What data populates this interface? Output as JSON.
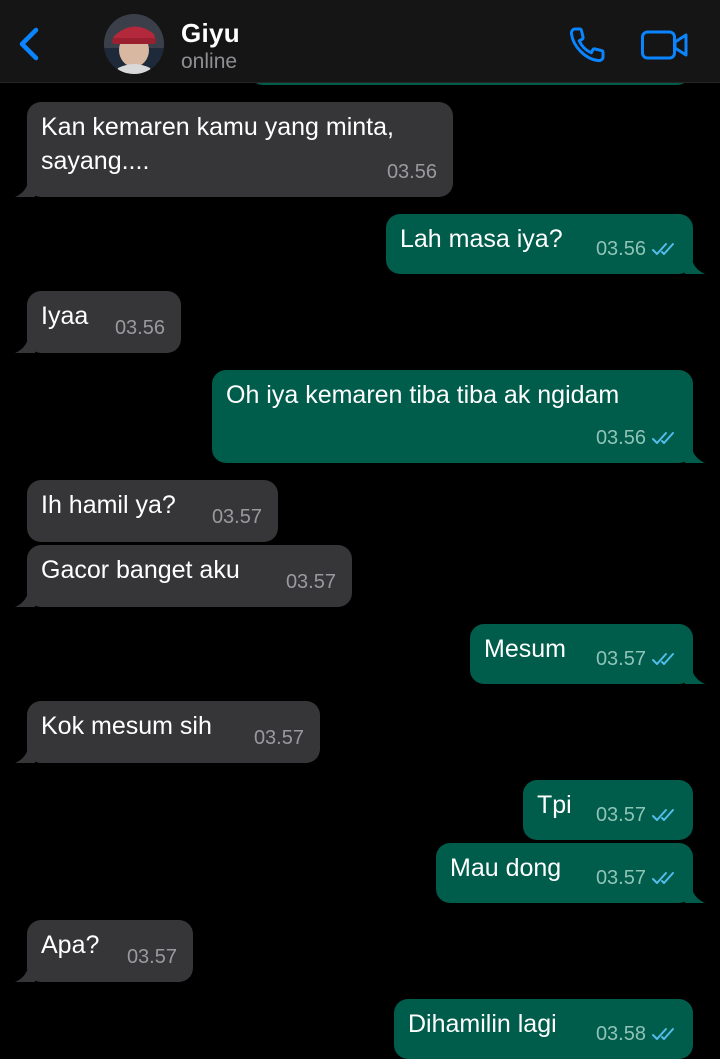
{
  "header": {
    "contact_name": "Giyu",
    "status": "online",
    "back_icon": "chevron-left-icon",
    "call_icon": "phone-icon",
    "video_icon": "video-camera-icon",
    "accent_color": "#0a84ff"
  },
  "colors": {
    "incoming_bubble": "#363638",
    "outgoing_bubble": "#005c4b",
    "read_ticks": "#53bdeb"
  },
  "messages": [
    {
      "direction": "in",
      "text_line1": "Kan kemaren kamu yang minta,",
      "text_line2": "sayang....",
      "time": "03.56"
    },
    {
      "direction": "out",
      "text": "Lah masa iya?",
      "time": "03.56",
      "status": "read"
    },
    {
      "direction": "in",
      "text": "Iyaa",
      "time": "03.56"
    },
    {
      "direction": "out",
      "text": "Oh iya kemaren tiba tiba ak ngidam",
      "time": "03.56",
      "status": "read"
    },
    {
      "direction": "in",
      "text": "Ih hamil ya?",
      "time": "03.57"
    },
    {
      "direction": "in",
      "text": "Gacor banget aku",
      "time": "03.57"
    },
    {
      "direction": "out",
      "text": "Mesum",
      "time": "03.57",
      "status": "read"
    },
    {
      "direction": "in",
      "text": "Kok mesum sih",
      "time": "03.57"
    },
    {
      "direction": "out",
      "text": "Tpi",
      "time": "03.57",
      "status": "read"
    },
    {
      "direction": "out",
      "text": "Mau dong",
      "time": "03.57",
      "status": "read"
    },
    {
      "direction": "in",
      "text": "Apa?",
      "time": "03.57"
    },
    {
      "direction": "out",
      "text": "Dihamilin lagi",
      "time": "03.58",
      "status": "read"
    }
  ]
}
